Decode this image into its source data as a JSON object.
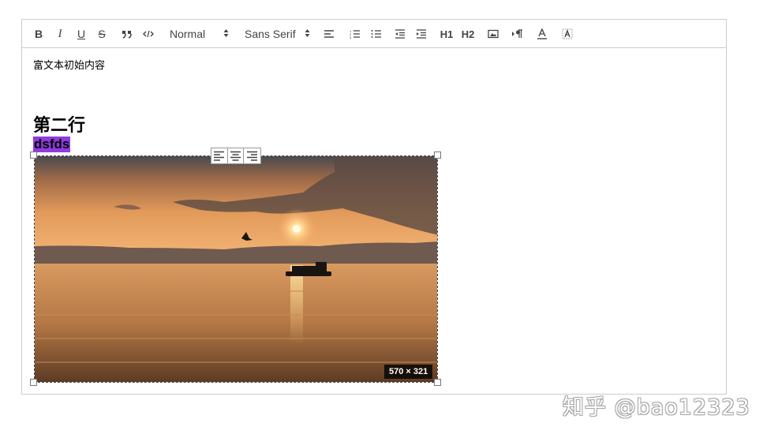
{
  "toolbar": {
    "bold_label": "B",
    "italic_label": "I",
    "underline_label": "U",
    "strike_label": "S",
    "header_picker": "Normal",
    "font_picker": "Sans Serif",
    "h1_label": "H1",
    "h2_label": "H2",
    "icons": [
      "bold-icon",
      "italic-icon",
      "underline-icon",
      "strike-icon",
      "blockquote-icon",
      "code-icon",
      "align-left-icon",
      "ordered-list-icon",
      "bullet-list-icon",
      "outdent-icon",
      "indent-icon",
      "header1-icon",
      "header2-icon",
      "image-icon",
      "rtl-direction-icon",
      "text-color-icon",
      "background-color-icon"
    ]
  },
  "content": {
    "paragraph": "富文本初始内容",
    "heading": "第二行",
    "selected_text": "dsfds",
    "selection_color": "#8f3be0"
  },
  "image": {
    "size_label": "570 × 321",
    "align_options": [
      "align-left-icon",
      "align-center-icon",
      "align-right-icon"
    ]
  },
  "watermark": "知乎 @bao12323"
}
